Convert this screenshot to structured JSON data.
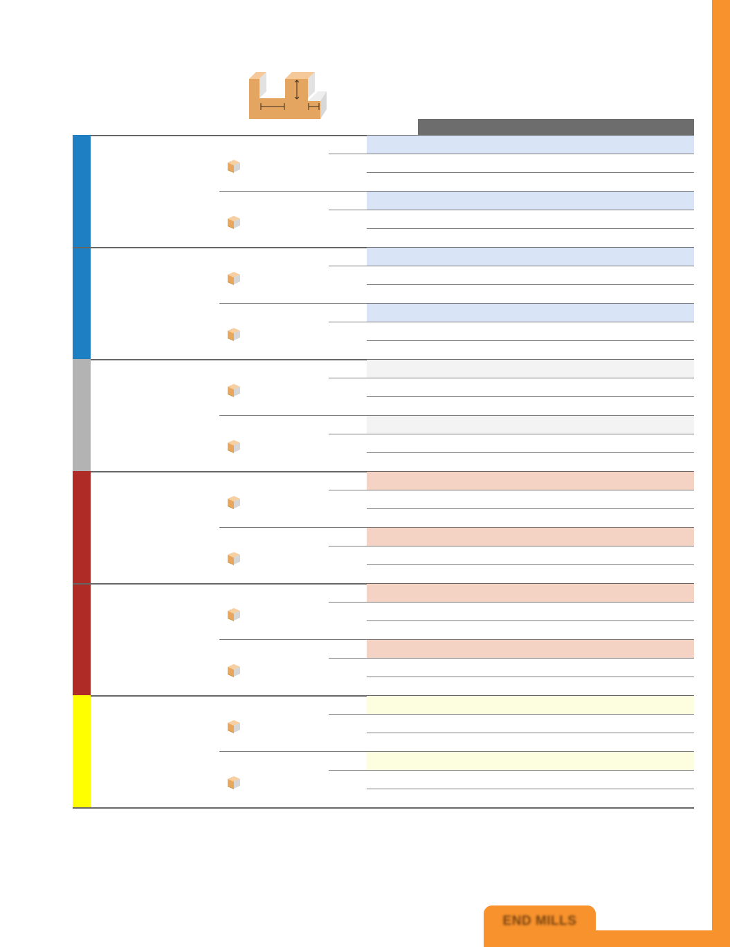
{
  "footer": {
    "tab_label": "END MILLS"
  },
  "colors": {
    "accent_orange": "#f7922d",
    "header_bar": "#6d6d6d",
    "groups": [
      "#1f7fc3",
      "#1f7fc3",
      "#b3b3b3",
      "#ae2b26",
      "#ae2b26",
      "#ffff00"
    ],
    "group_shades": [
      "#d9e5f7",
      "#d9e5f7",
      "#f3f3f3",
      "#f4d3c4",
      "#f4d3c4",
      "#fdfde0"
    ]
  },
  "icons": {
    "profile": "end-mill-cutting-profile-icon",
    "row": "tool-box-icon"
  },
  "bands": [
    {
      "color": "#1f7fc3",
      "groups": 2
    },
    {
      "color": "#b3b3b3",
      "groups": 1
    },
    {
      "color": "#ae2b26",
      "groups": 2
    },
    {
      "color": "#ffff00",
      "groups": 1
    }
  ]
}
